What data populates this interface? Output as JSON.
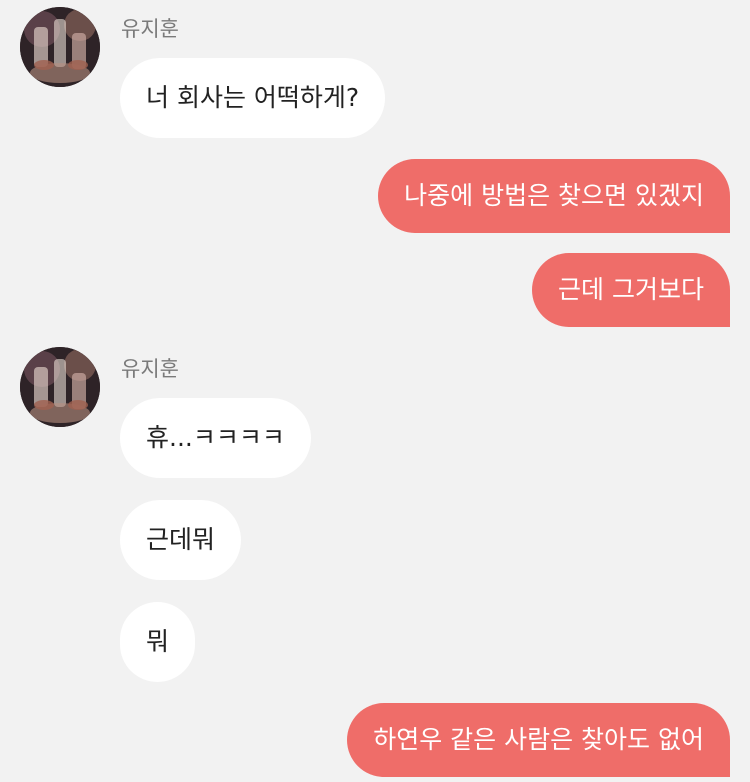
{
  "messages": [
    {
      "sender": "유지훈",
      "text": "너 회사는 어떡하게?"
    },
    {
      "text": "나중에 방법은 찾으면 있겠지"
    },
    {
      "text": "근데 그거보다"
    },
    {
      "sender": "유지훈",
      "text": "휴...ㅋㅋㅋㅋ"
    },
    {
      "text": "근데뭐"
    },
    {
      "text": "뭐"
    },
    {
      "text": "하연우 같은 사람은 찾아도 없어"
    }
  ],
  "colors": {
    "background": "#f2f2f2",
    "incoming_bubble": "#ffffff",
    "outgoing_bubble": "#ef6d69",
    "sender_name": "#7a7a7a"
  }
}
